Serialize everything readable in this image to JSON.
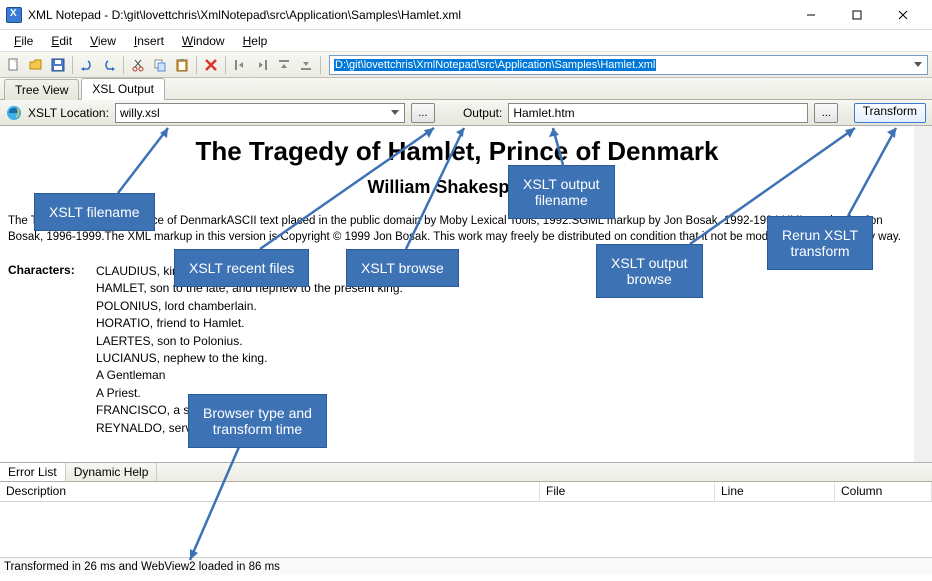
{
  "window": {
    "title": "XML Notepad - D:\\git\\lovettchris\\XmlNotepad\\src\\Application\\Samples\\Hamlet.xml"
  },
  "menu": {
    "file": "File",
    "edit": "Edit",
    "view": "View",
    "insert": "Insert",
    "window": "Window",
    "help": "Help"
  },
  "path": "D:\\git\\lovettchris\\XmlNotepad\\src\\Application\\Samples\\Hamlet.xml",
  "tabs": {
    "tree": "Tree View",
    "xsl": "XSL Output"
  },
  "xsl": {
    "loc_label": "XSLT Location:",
    "loc_value": "willy.xsl",
    "browse": "...",
    "out_label": "Output:",
    "out_value": "Hamlet.htm",
    "out_browse": "...",
    "transform": "Transform"
  },
  "doc": {
    "title": "The Tragedy of Hamlet, Prince of Denmark",
    "author": "William Shakespeare",
    "blurb": "The Tragedy of Hamlet, Prince of DenmarkASCII text placed in the public domain by Moby Lexical Tools, 1992.SGML markup by Jon Bosak, 1992-1994.XML version by Jon Bosak, 1996-1999.The XML markup in this version is Copyright © 1999 Jon Bosak. This work may freely be distributed on condition that it not be modified or altered in any way.",
    "char_label": "Characters:",
    "chars": [
      "CLAUDIUS, king of Denmark.",
      "HAMLET, son to the late, and nephew to the present king.",
      "POLONIUS, lord chamberlain.",
      "HORATIO, friend to Hamlet.",
      "LAERTES, son to Polonius.",
      "LUCIANUS, nephew to the king.",
      "A Gentleman",
      "A Priest.",
      "FRANCISCO, a soldier.",
      "REYNALDO, servant to Polonius."
    ]
  },
  "bottom": {
    "errlist": "Error List",
    "dynhelp": "Dynamic Help"
  },
  "grid": {
    "desc": "Description",
    "file": "File",
    "line": "Line",
    "col": "Column"
  },
  "status": "Transformed in 26 ms and WebView2 loaded in 86 ms",
  "callouts": {
    "c1": "XSLT filename",
    "c2": "XSLT recent files",
    "c3": "XSLT browse",
    "c4": "XSLT output\nfilename",
    "c5": "XSLT output\nbrowse",
    "c6": "Rerun XSLT\ntransform",
    "c7": "Browser type and\ntransform time"
  }
}
